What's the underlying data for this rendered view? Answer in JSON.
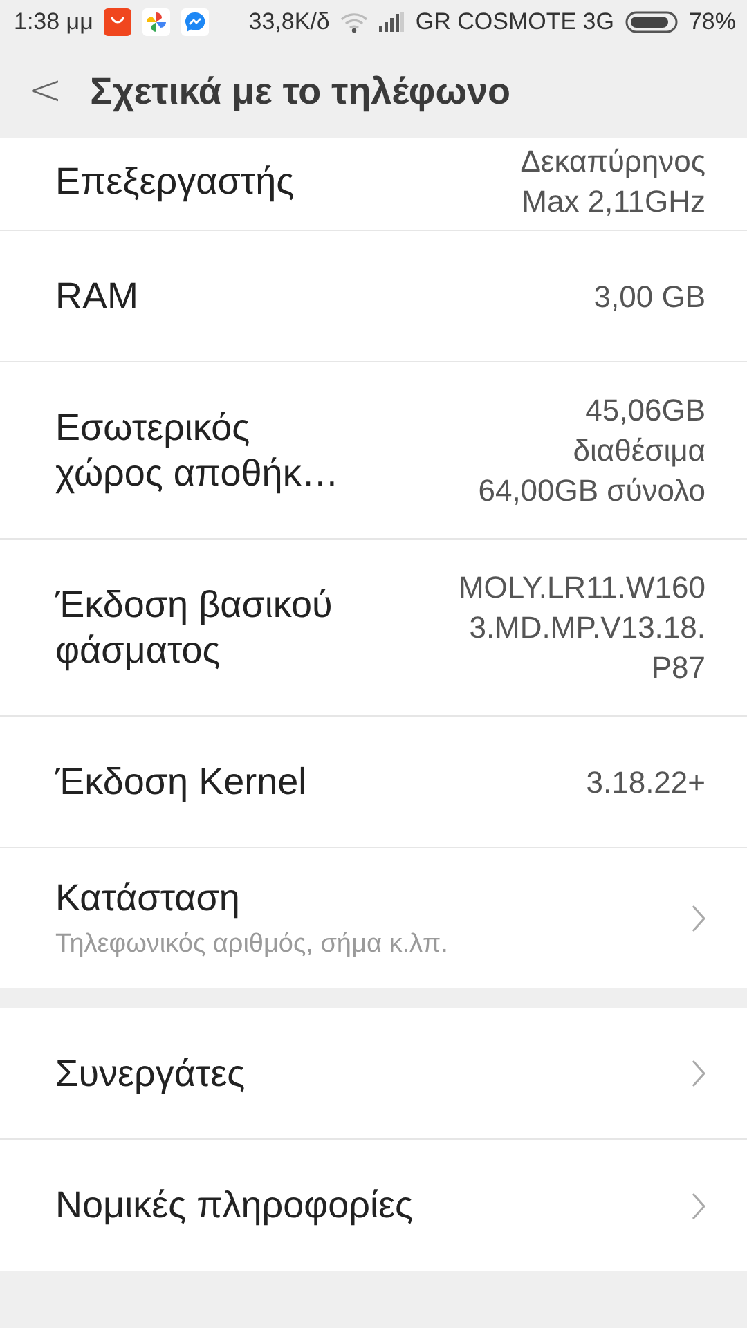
{
  "status_bar": {
    "time": "1:38 μμ",
    "speed": "33,8K/δ",
    "carrier": "GR COSMOTE 3G",
    "battery": "78%"
  },
  "header": {
    "back": "<",
    "title": "Σχετικά με το τηλέφωνο"
  },
  "sections": [
    {
      "items": [
        {
          "kind": "info",
          "label": [
            "Επεξεργαστής"
          ],
          "value": [
            "Δεκαπύρηνος",
            "Max 2,11GHz"
          ]
        },
        {
          "kind": "info",
          "label": [
            "RAM"
          ],
          "value": [
            "3,00 GB"
          ]
        },
        {
          "kind": "info",
          "label": [
            "Εσωτερικός",
            "χώρος αποθήκ…"
          ],
          "value": [
            "45,06GB",
            "διαθέσιμα",
            "64,00GB σύνολο"
          ]
        },
        {
          "kind": "info",
          "label": [
            "Έκδοση βασικού",
            "φάσματος"
          ],
          "value": [
            "MOLY.LR11.W160",
            "3.MD.MP.V13.18.",
            "P87"
          ]
        },
        {
          "kind": "info",
          "label": [
            "Έκδοση Kernel"
          ],
          "value": [
            "3.18.22+"
          ]
        },
        {
          "kind": "link",
          "label": [
            "Κατάσταση"
          ],
          "subtitle": "Τηλεφωνικός αριθμός, σήμα κ.λπ."
        }
      ]
    },
    {
      "items": [
        {
          "kind": "link",
          "label": [
            "Συνεργάτες"
          ]
        },
        {
          "kind": "link",
          "label": [
            "Νομικές πληροφορίες"
          ]
        }
      ]
    }
  ]
}
